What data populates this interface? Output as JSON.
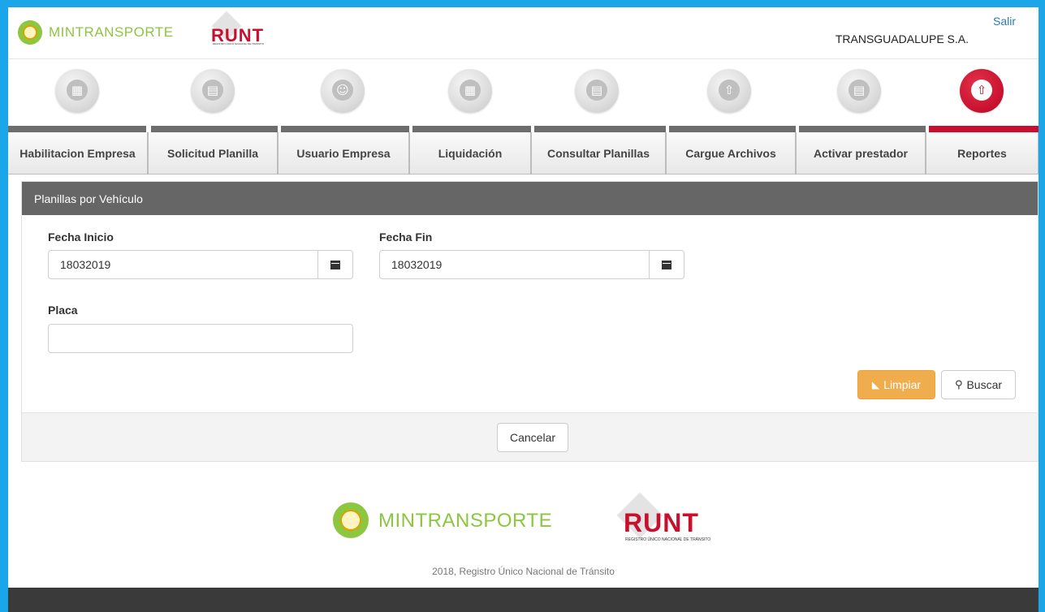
{
  "header": {
    "mintransporte_logo": "MINTRANSPORTE",
    "runt_logo": "RUNT",
    "runt_subtitle": "REGISTRO ÚNICO NACIONAL DE TRÁNSITO",
    "logout_link": "Salir",
    "company_name": "TRANSGUADALUPE S.A."
  },
  "nav": {
    "items": [
      {
        "label": "Habilitacion Empresa",
        "icon": "building-icon",
        "active": false
      },
      {
        "label": "Solicitud Planilla",
        "icon": "document-icon",
        "active": false
      },
      {
        "label": "Usuario Empresa",
        "icon": "user-icon",
        "active": false
      },
      {
        "label": "Liquidación",
        "icon": "calculator-icon",
        "active": false
      },
      {
        "label": "Consultar Planillas",
        "icon": "document-search-icon",
        "active": false
      },
      {
        "label": "Cargue Archivos",
        "icon": "cloud-upload-icon",
        "active": false
      },
      {
        "label": "Activar prestador",
        "icon": "document-icon",
        "active": false
      },
      {
        "label": "Reportes",
        "icon": "cloud-upload-icon",
        "active": true
      }
    ]
  },
  "panel": {
    "title": "Planillas por Vehículo",
    "fecha_inicio_label": "Fecha Inicio",
    "fecha_inicio_value": "18032019",
    "fecha_fin_label": "Fecha Fin",
    "fecha_fin_value": "18032019",
    "placa_label": "Placa",
    "placa_value": "",
    "limpiar_label": "Limpiar",
    "buscar_label": "Buscar",
    "cancelar_label": "Cancelar"
  },
  "footer": {
    "mintransporte_logo": "MINTRANSPORTE",
    "runt_logo": "RUNT",
    "runt_subtitle": "REGISTRO ÚNICO NACIONAL DE TRÁNSITO",
    "copyright": "2018, Registro Único Nacional de Tránsito"
  },
  "colors": {
    "accent_red": "#c8102e",
    "mintransporte_green": "#8dc63f",
    "frame_blue": "#1aa6e8",
    "warning_orange": "#f0ad4e"
  }
}
